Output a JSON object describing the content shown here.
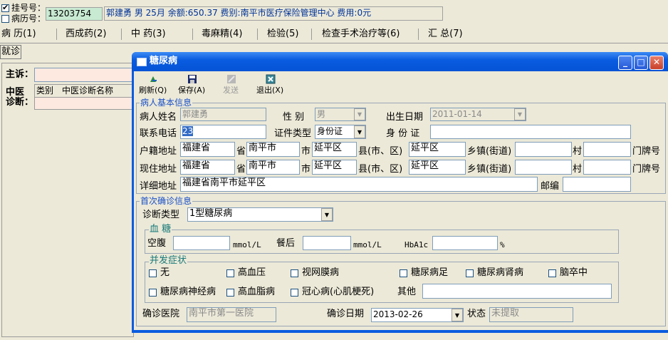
{
  "topbar": {
    "guahao_label": "挂号号：",
    "bingli_label": "病历号：",
    "guahao_checked": true,
    "bingli_checked": false,
    "id_value": "13203754",
    "patient_info": "郭建勇 男 25月 余额:650.37 费别:南平市医疗保险管理中心 费用:0元"
  },
  "tabs": [
    "病 历(1)",
    "西成药(2)",
    "中 药(3)",
    "毒麻精(4)",
    "检验(5)",
    "检查手术治疗等(6)",
    "汇 总(7)"
  ],
  "left": {
    "jiuzhen": "就诊",
    "zhusu": "主诉：",
    "zhongyi_l1": "中医",
    "zhongyi_l2": "诊断：",
    "col_type": "类别",
    "col_name": "中医诊断名称"
  },
  "dialog": {
    "title": "糖尿病",
    "toolbar": {
      "refresh": "刷新(Q)",
      "save": "保存(A)",
      "send": "发送",
      "exit": "退出(X)"
    },
    "basic": {
      "legend": "病人基本信息",
      "name_label": "病人姓名",
      "name_value": "郭建勇",
      "gender_label": "性 别",
      "gender_value": "男",
      "birth_label": "出生日期",
      "birth_value": "2011-01-14",
      "phone_label": "联系电话",
      "phone_value": "23",
      "idtype_label": "证件类型",
      "idtype_value": "身份证",
      "idno_label": "身 份 证",
      "idno_value": "",
      "hukou_label": "户籍地址",
      "current_label": "现住地址",
      "province_value": "福建省",
      "city_value": "南平市",
      "county_value": "延平区",
      "town_value": "延平区",
      "sheng": "省",
      "shi": "市",
      "xian": "县(市、区)",
      "xiang": "乡镇(街道)",
      "cun": "村",
      "menpai": "门牌号",
      "detail_label": "详细地址",
      "detail_value": "福建省南平市延平区",
      "postcode_label": "邮编",
      "postcode_value": ""
    },
    "diag": {
      "legend": "首次确诊信息",
      "type_label": "诊断类型",
      "type_value": "1型糖尿病",
      "sugar_legend": "血  糖",
      "fasting_label": "空腹",
      "fasting_value": "",
      "unit": "mmol/L",
      "post_label": "餐后",
      "post_value": "",
      "hba1c_label": "HbA1c",
      "hba1c_value": "",
      "percent": "%",
      "comp_legend": "并发症状",
      "complications": [
        "无",
        "高血压",
        "视网膜病",
        "糖尿病足",
        "糖尿病肾病",
        "脑卒中",
        "糖尿病神经病",
        "高血脂病",
        "冠心病(心肌梗死)"
      ],
      "other_label": "其他",
      "other_value": "",
      "hospital_label": "确诊医院",
      "hospital_value": "南平市第一医院",
      "date_label": "确诊日期",
      "date_value": "2013-02-26",
      "status_label": "状态",
      "status_value": "未提取"
    }
  },
  "colors": {
    "titlebar": "#0a5ce0",
    "window_bg": "#ece9d8",
    "legend_text": "#1a50c8",
    "info_text": "#003399",
    "id_field_bg": "#c8ead2",
    "selection": "#316ac5"
  }
}
